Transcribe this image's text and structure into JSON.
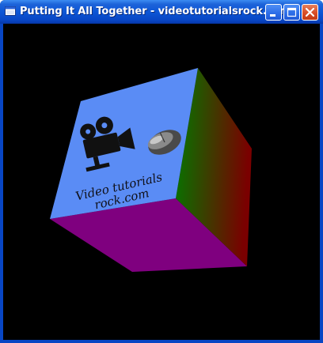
{
  "window": {
    "title": "Putting It All Together - videotutorialsrock.com",
    "icon": "app-window-icon",
    "controls": [
      "minimize-icon",
      "maximize-icon",
      "close-icon"
    ]
  },
  "scene": {
    "background_color": "#000000",
    "cube": {
      "front_face_color": "#5a8cf5",
      "bottom_face_color": "#7f007f",
      "right_face_colors": [
        "#007a00",
        "#7a0000"
      ],
      "front_face_text": {
        "line1": "Video tutorials",
        "line2": "rock.com"
      },
      "front_face_images": [
        "movie-camera-icon",
        "computer-mouse-icon"
      ]
    }
  }
}
